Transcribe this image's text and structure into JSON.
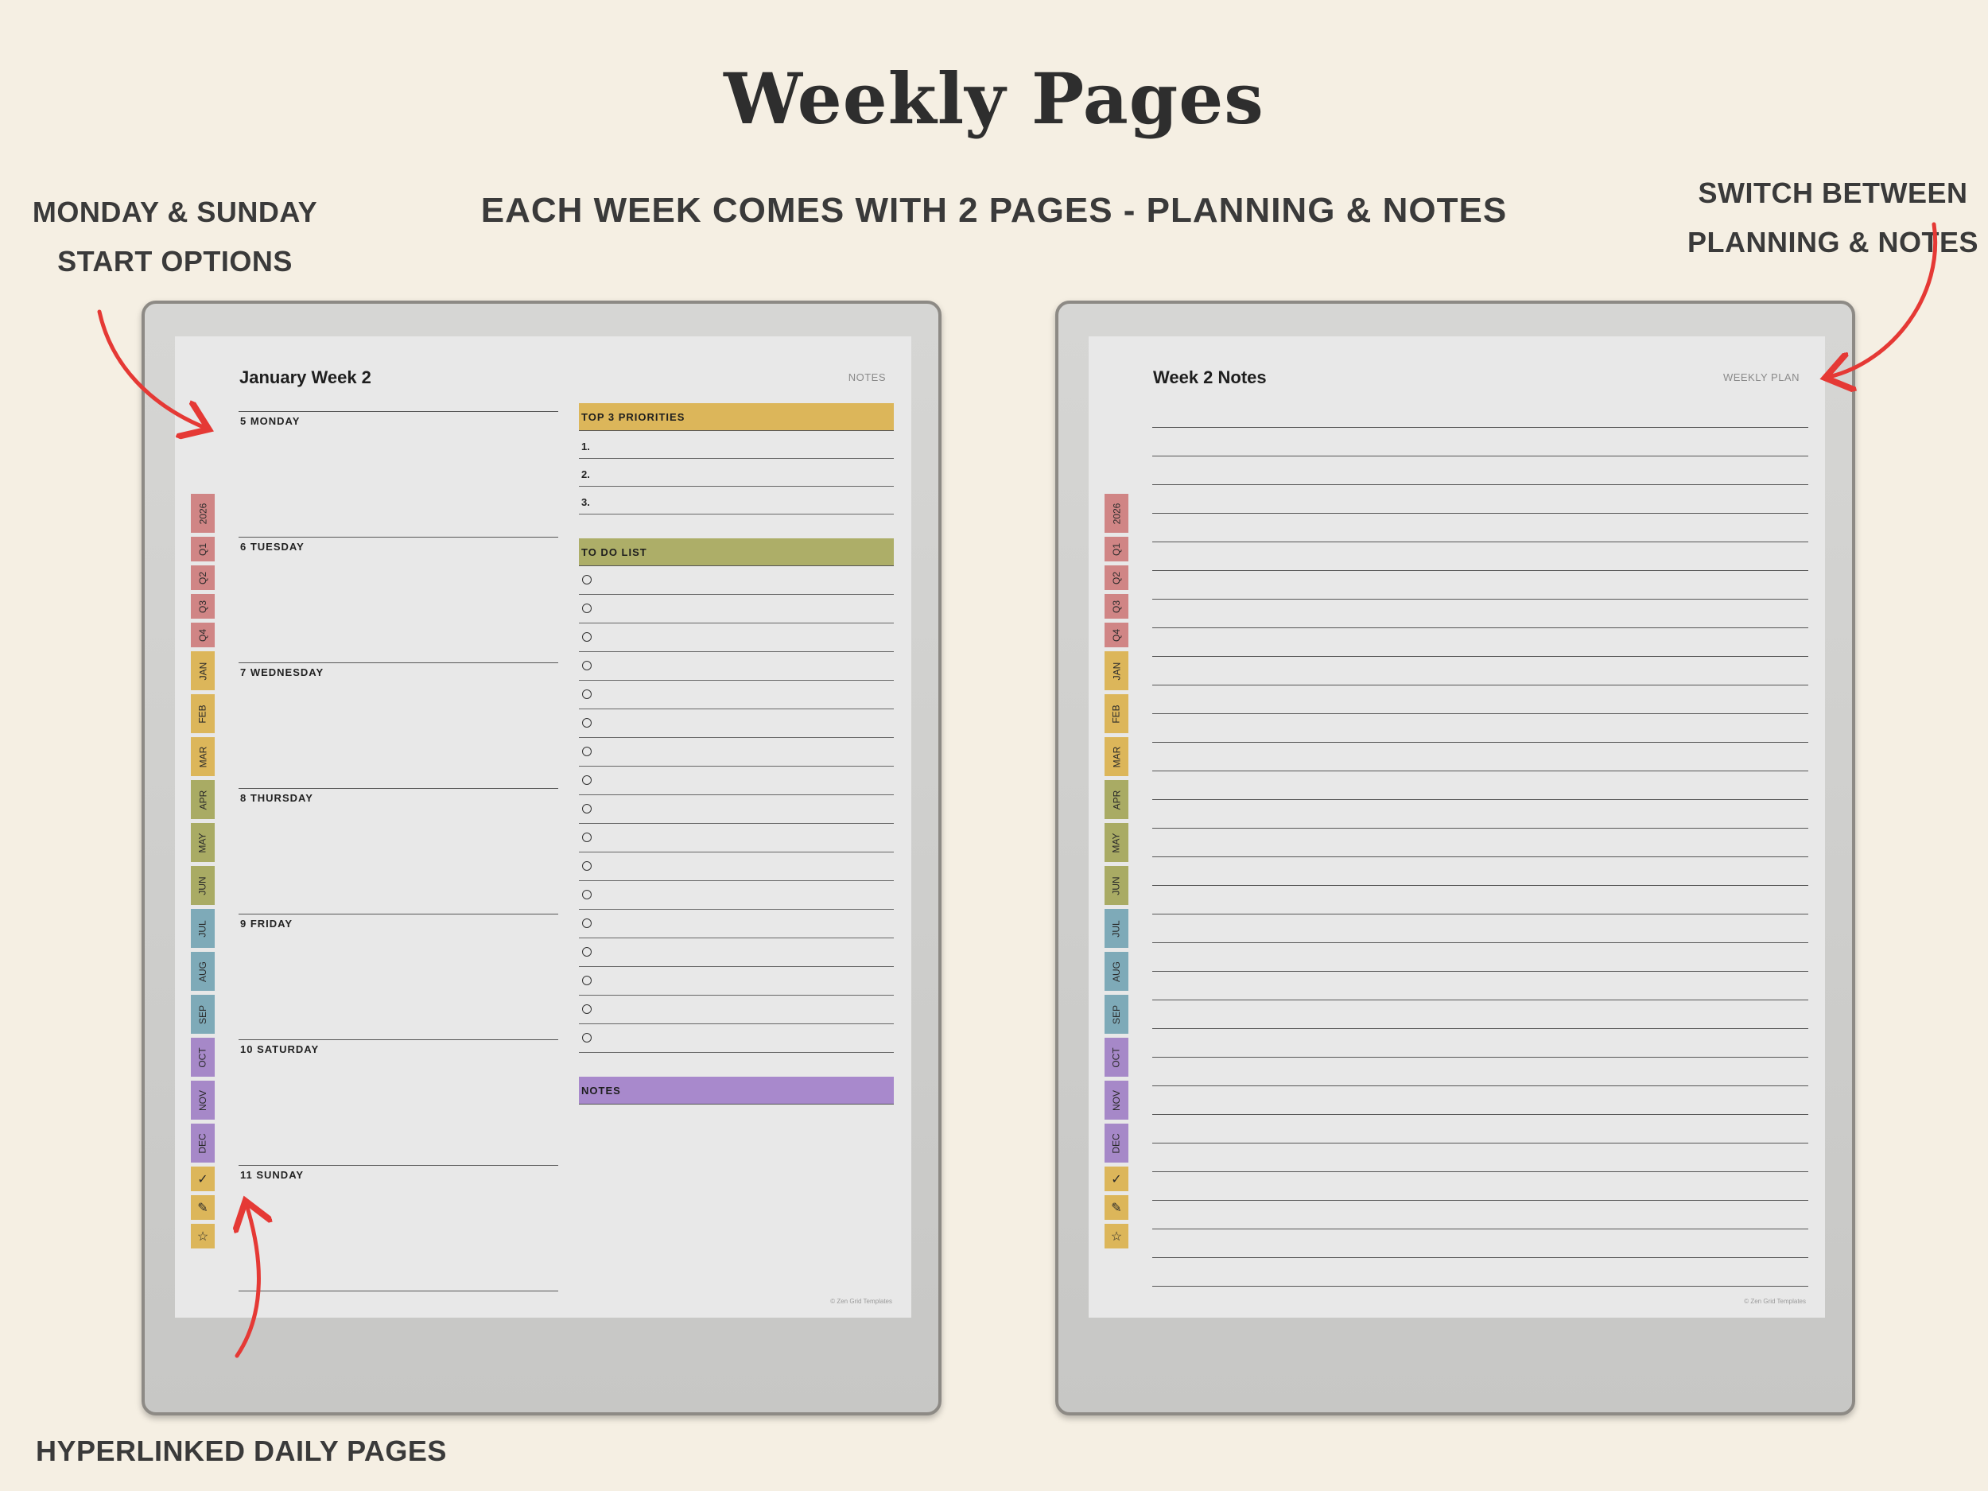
{
  "header": {
    "title": "Weekly Pages",
    "subtitle": "EACH WEEK COMES WITH 2 PAGES - PLANNING & NOTES"
  },
  "callouts": {
    "left_top_line1": "MONDAY & SUNDAY",
    "left_top_line2": "START OPTIONS",
    "right_top_line1": "SWITCH BETWEEN",
    "right_top_line2": "PLANNING & NOTES",
    "bottom_left": "HYPERLINKED DAILY PAGES"
  },
  "colors": {
    "background": "#f5efe3",
    "tab_red": "#d08585",
    "tab_yellow": "#dcb65a",
    "tab_olive": "#a9ab64",
    "tab_blue": "#7eaab8",
    "tab_purple": "#a688c8",
    "priorities_header": "#dcb65a",
    "todo_header": "#adae68",
    "notes_header": "#a889cc",
    "arrow": "#e53935"
  },
  "tabs": [
    {
      "label": "2026",
      "color": "#d08585",
      "icon": ""
    },
    {
      "label": "Q1",
      "color": "#d08585",
      "icon": ""
    },
    {
      "label": "Q2",
      "color": "#d08585",
      "icon": ""
    },
    {
      "label": "Q3",
      "color": "#d08585",
      "icon": ""
    },
    {
      "label": "Q4",
      "color": "#d08585",
      "icon": ""
    },
    {
      "label": "JAN",
      "color": "#dcb65a",
      "icon": ""
    },
    {
      "label": "FEB",
      "color": "#dcb65a",
      "icon": ""
    },
    {
      "label": "MAR",
      "color": "#dcb65a",
      "icon": ""
    },
    {
      "label": "APR",
      "color": "#a9ab64",
      "icon": ""
    },
    {
      "label": "MAY",
      "color": "#a9ab64",
      "icon": ""
    },
    {
      "label": "JUN",
      "color": "#a9ab64",
      "icon": ""
    },
    {
      "label": "JUL",
      "color": "#7eaab8",
      "icon": ""
    },
    {
      "label": "AUG",
      "color": "#7eaab8",
      "icon": ""
    },
    {
      "label": "SEP",
      "color": "#7eaab8",
      "icon": ""
    },
    {
      "label": "OCT",
      "color": "#a688c8",
      "icon": ""
    },
    {
      "label": "NOV",
      "color": "#a688c8",
      "icon": ""
    },
    {
      "label": "DEC",
      "color": "#a688c8",
      "icon": ""
    },
    {
      "label": "✓",
      "color": "#dcb65a",
      "icon": "checkmark-icon"
    },
    {
      "label": "✎",
      "color": "#dcb65a",
      "icon": "pencil-icon"
    },
    {
      "label": "☆",
      "color": "#dcb65a",
      "icon": "star-icon"
    }
  ],
  "planning_page": {
    "title": "January Week 2",
    "link_label": "NOTES",
    "days": [
      "5 MONDAY",
      "6 TUESDAY",
      "7 WEDNESDAY",
      "8 THURSDAY",
      "9 FRIDAY",
      "10 SATURDAY",
      "11 SUNDAY"
    ],
    "priorities_label": "TOP 3 PRIORITIES",
    "priorities": [
      "1.",
      "2.",
      "3."
    ],
    "todo_label": "TO DO LIST",
    "todo_count": 17,
    "notes_label": "NOTES",
    "footer": "© Zen Grid Templates"
  },
  "notes_page": {
    "title": "Week 2 Notes",
    "link_label": "WEEKLY PLAN",
    "line_count": 31,
    "footer": "© Zen Grid Templates"
  }
}
